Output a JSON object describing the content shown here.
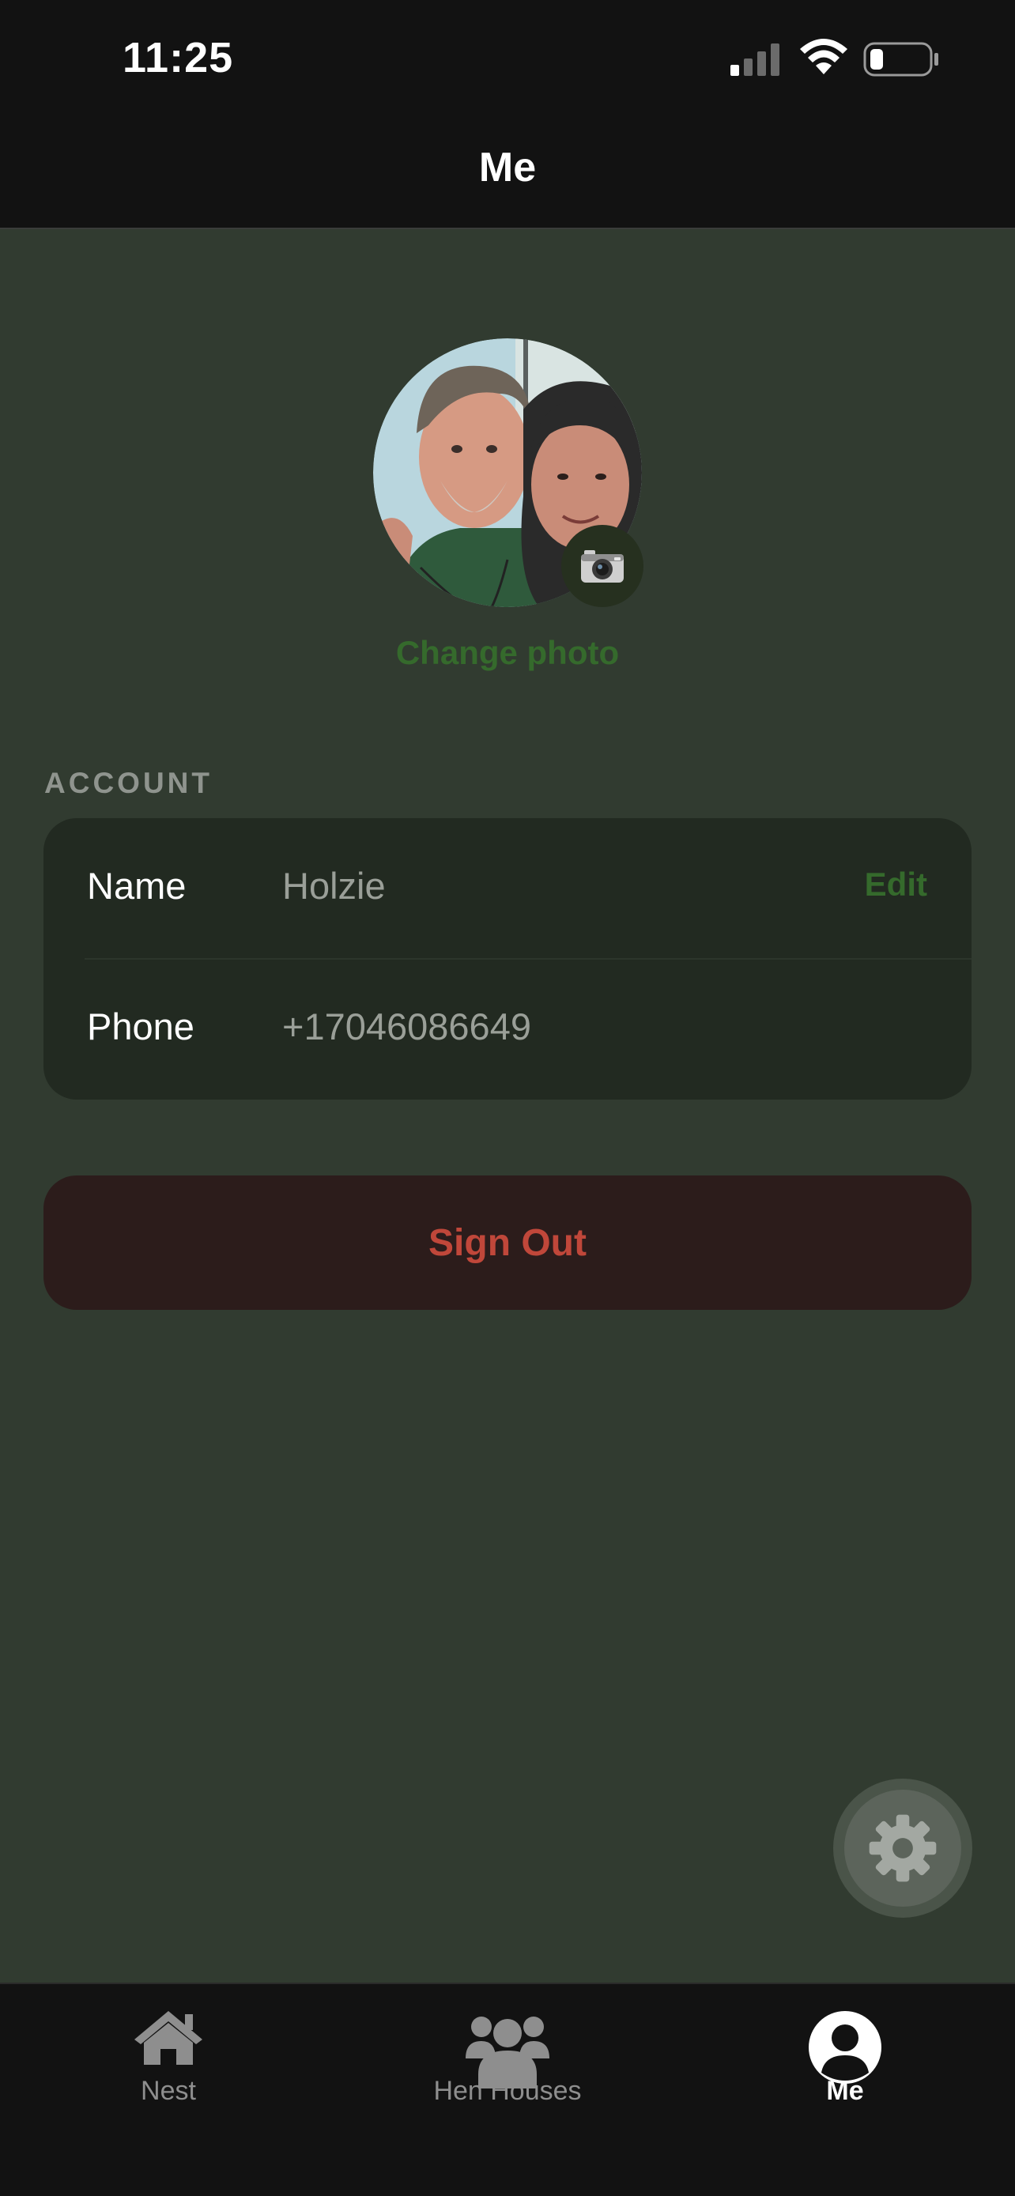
{
  "status_bar": {
    "time": "11:25",
    "icons": [
      "signal-icon",
      "wifi-icon",
      "battery-icon"
    ]
  },
  "nav": {
    "title": "Me"
  },
  "profile": {
    "change_photo_label": "Change photo",
    "avatar_icon": "avatar-photo",
    "camera_icon": "camera-icon"
  },
  "account": {
    "section_label": "ACCOUNT",
    "rows": [
      {
        "label": "Name",
        "value": "Holzie",
        "action": "Edit"
      },
      {
        "label": "Phone",
        "value": "+17046086649"
      }
    ]
  },
  "sign_out": {
    "label": "Sign Out"
  },
  "fab": {
    "icon": "gear-icon"
  },
  "tab_bar": {
    "tabs": [
      {
        "label": "Nest",
        "icon": "home-icon",
        "active": false
      },
      {
        "label": "Hen Houses",
        "icon": "group-icon",
        "active": false
      },
      {
        "label": "Me",
        "icon": "profile-icon",
        "active": true
      }
    ]
  },
  "colors": {
    "background": "#313b30",
    "card": "#222a21",
    "accent_green": "#356a2c",
    "sign_out_bg": "#2c1c1b",
    "sign_out_text": "#c0473a",
    "bars": "#121212"
  }
}
